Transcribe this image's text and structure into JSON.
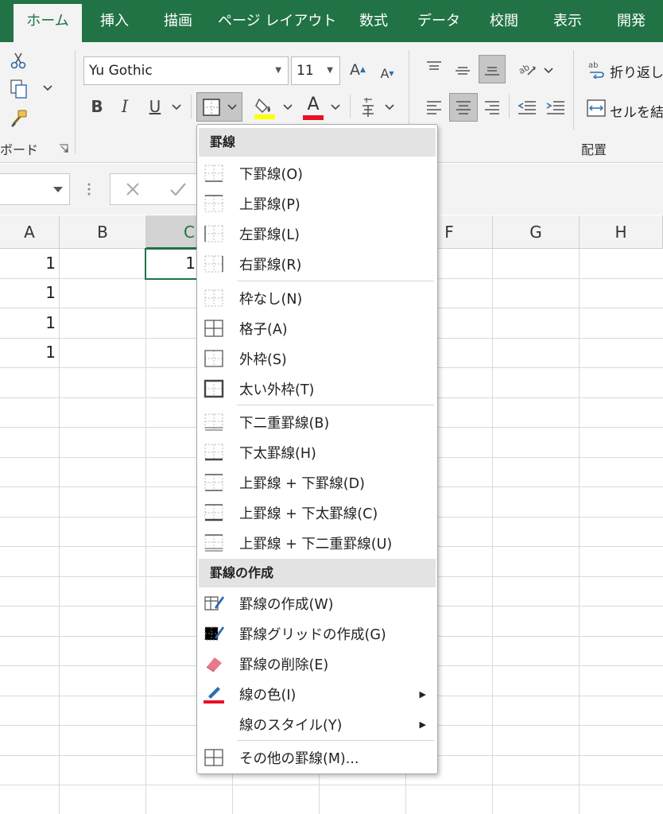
{
  "tabs": [
    "ホーム",
    "挿入",
    "描画",
    "ページ レイアウト",
    "数式",
    "データ",
    "校閲",
    "表示",
    "開発"
  ],
  "ribbon": {
    "font_name": "Yu Gothic",
    "font_size": "11",
    "bold_label": "B",
    "italic_label": "I",
    "underline_label": "U",
    "font_color_letter": "A",
    "grow_font_label": "A",
    "shrink_font_label": "A",
    "wrap_text_label": "折り返し",
    "merge_label": "セルを結",
    "clipboard_group": "ボード",
    "alignment_group": "配置"
  },
  "columns": [
    "A",
    "B",
    "C",
    "D",
    "E",
    "F",
    "G",
    "H"
  ],
  "cells": {
    "a1": "1",
    "a2": "1",
    "a3": "1",
    "a4": "1",
    "c1": "1"
  },
  "menu": {
    "section1": "罫線",
    "section2": "罫線の作成",
    "items": [
      "下罫線(O)",
      "上罫線(P)",
      "左罫線(L)",
      "右罫線(R)",
      "枠なし(N)",
      "格子(A)",
      "外枠(S)",
      "太い外枠(T)",
      "下二重罫線(B)",
      "下太罫線(H)",
      "上罫線 + 下罫線(D)",
      "上罫線 + 下太罫線(C)",
      "上罫線 + 下二重罫線(U)",
      "罫線の作成(W)",
      "罫線グリッドの作成(G)",
      "罫線の削除(E)",
      "線の色(I)",
      "線のスタイル(Y)",
      "その他の罫線(M)..."
    ]
  },
  "colors": {
    "excel_green": "#217346",
    "highlight_yellow": "#ffff00",
    "font_red": "#e81123"
  },
  "icons": {
    "cut": "scissors-icon",
    "copy": "copy-icon",
    "format_painter": "paintbrush-icon",
    "borders": "border-icon",
    "fill": "paint-bucket-icon",
    "eraser": "eraser-icon",
    "pencil": "pencil-icon"
  }
}
